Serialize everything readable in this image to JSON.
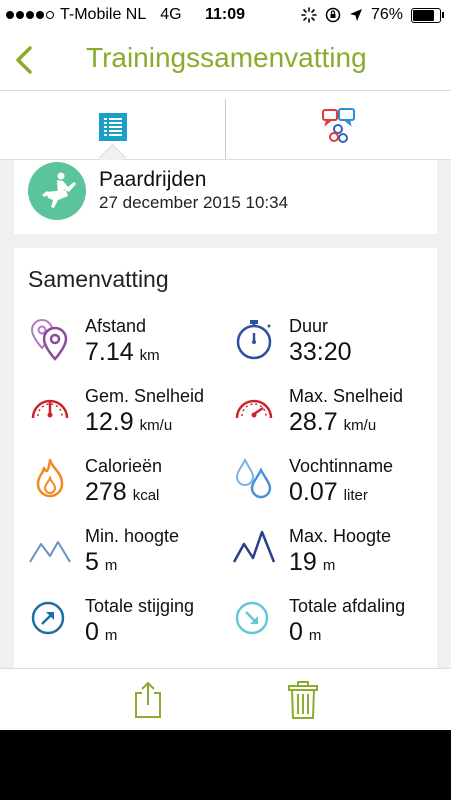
{
  "status": {
    "carrier": "T-Mobile NL",
    "network": "4G",
    "time": "11:09",
    "battery": "76%",
    "battery_level": 0.76
  },
  "nav": {
    "title": "Trainingssamenvatting",
    "back_icon": "chevron-left-icon"
  },
  "tabs": [
    {
      "icon": "list-icon",
      "active": true
    },
    {
      "icon": "chat-bubbles-icon",
      "active": false
    }
  ],
  "activity": {
    "name": "Paardrijden",
    "date": "27 december 2015 10:34",
    "icon": "horse-rider-icon"
  },
  "summary": {
    "title": "Samenvatting",
    "stats": [
      {
        "label": "Afstand",
        "value": "7.14",
        "unit": "km",
        "icon": "location-pins-icon"
      },
      {
        "label": "Duur",
        "value": "33:20",
        "unit": "",
        "icon": "stopwatch-icon"
      },
      {
        "label": "Gem. Snelheid",
        "value": "12.9",
        "unit": "km/u",
        "icon": "speedometer-avg-icon"
      },
      {
        "label": "Max. Snelheid",
        "value": "28.7",
        "unit": "km/u",
        "icon": "speedometer-max-icon"
      },
      {
        "label": "Calorieën",
        "value": "278",
        "unit": "kcal",
        "icon": "flame-icon"
      },
      {
        "label": "Vochtinname",
        "value": "0.07",
        "unit": "liter",
        "icon": "water-drops-icon"
      },
      {
        "label": "Min. hoogte",
        "value": "5",
        "unit": "m",
        "icon": "mountains-low-icon"
      },
      {
        "label": "Max. Hoogte",
        "value": "19",
        "unit": "m",
        "icon": "mountains-high-icon"
      },
      {
        "label": "Totale stijging",
        "value": "0",
        "unit": "m",
        "icon": "arrow-up-right-circle-icon"
      },
      {
        "label": "Totale afdaling",
        "value": "0",
        "unit": "m",
        "icon": "arrow-down-right-circle-icon"
      }
    ]
  },
  "colors": {
    "accent": "#8aab2c",
    "activity": "#5cc49a",
    "distance": "#8b4a9c",
    "time": "#2f4fa0",
    "speed": "#c8262e",
    "calories": "#f08a1c",
    "water": "#4a90d9",
    "altitude": "#5a7fc0",
    "ascent": "#1b6fa8",
    "descent": "#66c5d8"
  }
}
